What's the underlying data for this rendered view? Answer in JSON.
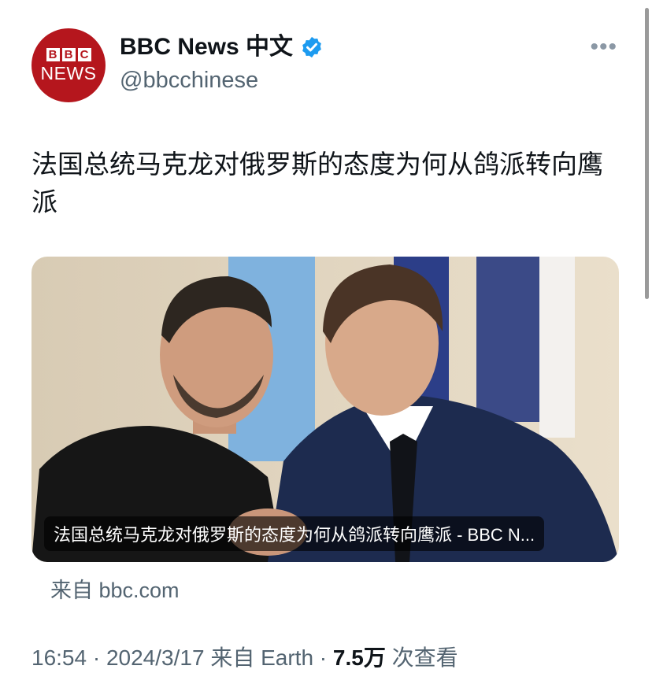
{
  "account": {
    "avatar_top": "BBC",
    "avatar_bottom": "NEWS",
    "name": "BBC News 中文",
    "handle": "@bbcchinese",
    "verified_color": "#1d9bf0",
    "brand_color": "#b5161d"
  },
  "menu": {
    "more_icon": "more-horizontal-icon",
    "more_glyph": "•••"
  },
  "tweet": {
    "text": "法国总统马克龙对俄罗斯的态度为何从鸽派转向鹰派"
  },
  "card": {
    "caption": "法国总统马克龙对俄罗斯的态度为何从鸽派转向鹰派 - BBC N...",
    "source": "来自 bbc.com"
  },
  "meta": {
    "time": "16:54",
    "sep1": " · ",
    "date": "2024/3/17",
    "client": " 来自 Earth",
    "sep2": " · ",
    "views": "7.5万",
    "views_label": " 次查看"
  }
}
